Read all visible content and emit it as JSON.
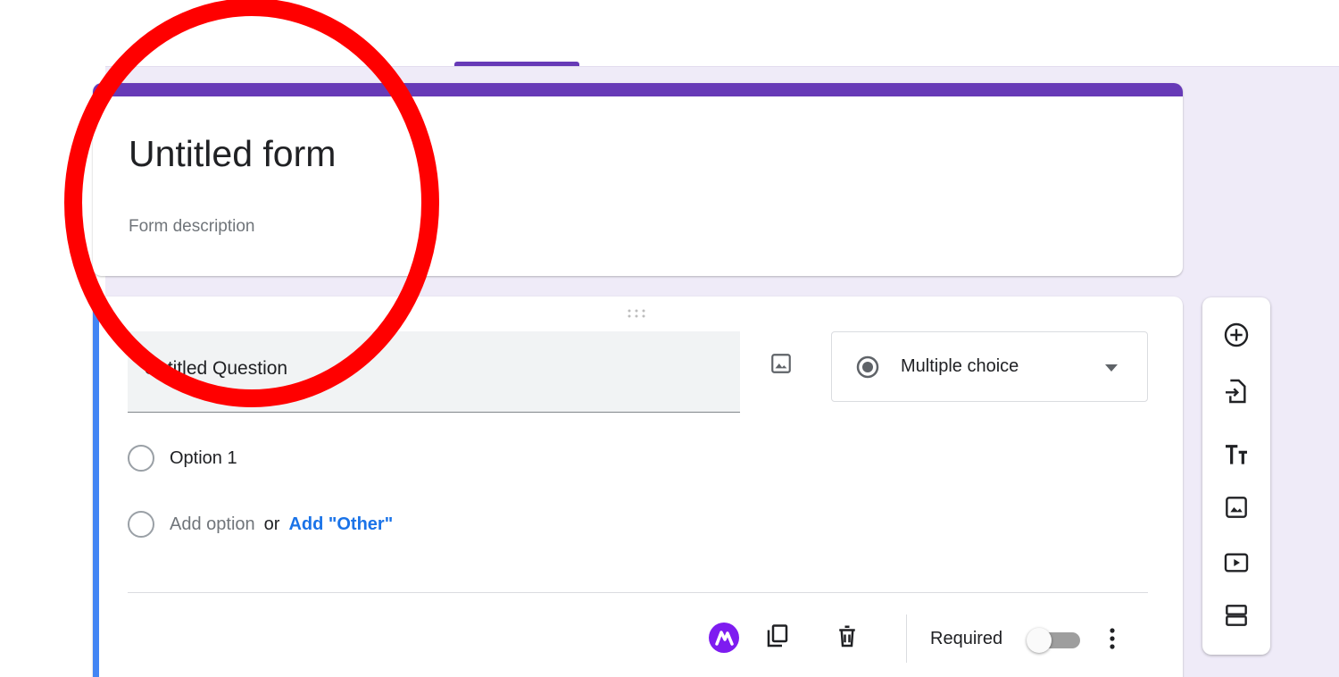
{
  "form": {
    "title": "Untitled form",
    "description": "Form description",
    "accent_color": "#673ab7"
  },
  "question": {
    "title": "Untitled Question",
    "type_label": "Multiple choice",
    "options": [
      {
        "label": "Option 1"
      }
    ],
    "add_option_label": "Add option",
    "or_label": "or",
    "add_other_label": "Add \"Other\"",
    "required_label": "Required",
    "required": false
  },
  "toolbar": {
    "items": [
      {
        "icon": "add-question-icon"
      },
      {
        "icon": "import-questions-icon"
      },
      {
        "icon": "add-title-description-icon"
      },
      {
        "icon": "add-image-icon"
      },
      {
        "icon": "add-video-icon"
      },
      {
        "icon": "add-section-icon"
      }
    ]
  },
  "annotation": {
    "shape": "ellipse",
    "color": "#ff0000"
  }
}
